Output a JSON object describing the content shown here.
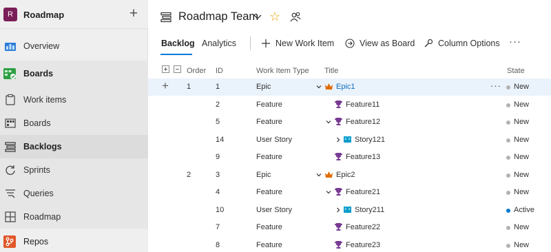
{
  "project": {
    "badge": "R",
    "name": "Roadmap"
  },
  "nav": {
    "overview": "Overview",
    "boards": "Boards",
    "work_items": "Work items",
    "boards_sub": "Boards",
    "backlogs": "Backlogs",
    "sprints": "Sprints",
    "queries": "Queries",
    "roadmap": "Roadmap",
    "repos": "Repos"
  },
  "header": {
    "team_title": "Roadmap Team"
  },
  "tabs": {
    "backlog": "Backlog",
    "analytics": "Analytics"
  },
  "toolbar": {
    "new_work_item": "New Work Item",
    "view_as_board": "View as Board",
    "column_options": "Column Options",
    "more": "···"
  },
  "columns": {
    "order": "Order",
    "id": "ID",
    "type": "Work Item Type",
    "title": "Title",
    "state": "State"
  },
  "rows": [
    {
      "order": "1",
      "id": "1",
      "type": "Epic",
      "title": "Epic1",
      "state": "New"
    },
    {
      "order": "",
      "id": "2",
      "type": "Feature",
      "title": "Feature11",
      "state": "New"
    },
    {
      "order": "",
      "id": "5",
      "type": "Feature",
      "title": "Feature12",
      "state": "New"
    },
    {
      "order": "",
      "id": "14",
      "type": "User Story",
      "title": "Story121",
      "state": "New"
    },
    {
      "order": "",
      "id": "9",
      "type": "Feature",
      "title": "Feature13",
      "state": "New"
    },
    {
      "order": "2",
      "id": "3",
      "type": "Epic",
      "title": "Epic2",
      "state": "New"
    },
    {
      "order": "",
      "id": "4",
      "type": "Feature",
      "title": "Feature21",
      "state": "New"
    },
    {
      "order": "",
      "id": "10",
      "type": "User Story",
      "title": "Story211",
      "state": "Active"
    },
    {
      "order": "",
      "id": "7",
      "type": "Feature",
      "title": "Feature22",
      "state": "New"
    },
    {
      "order": "",
      "id": "8",
      "type": "Feature",
      "title": "Feature23",
      "state": "New"
    }
  ],
  "colors": {
    "accent": "#0078d4",
    "epic": "#e06c00",
    "feature": "#773b93",
    "user_story": "#009ccc",
    "state_new": "#b2b2b2",
    "state_active": "#007acc"
  }
}
